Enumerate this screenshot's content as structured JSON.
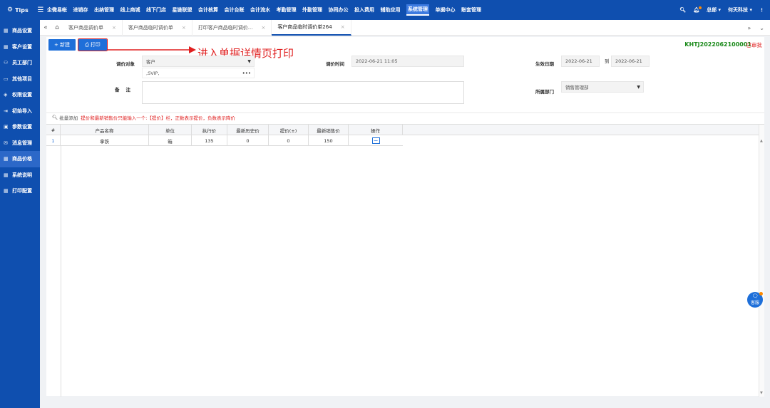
{
  "app": {
    "brand": "Tips"
  },
  "nav": {
    "items": [
      "企微易帐",
      "进销存",
      "出纳管理",
      "线上商城",
      "线下门店",
      "星链联盟",
      "会计核算",
      "会计台账",
      "会计流水",
      "考勤管理",
      "外勤管理",
      "协同办公",
      "投入费用",
      "辅助应用",
      "系统管理",
      "单据中心",
      "账套管理"
    ],
    "active_index": 14,
    "user": "总部",
    "company": "何天科技"
  },
  "sidebar": {
    "items": [
      {
        "icon": "grid-icon",
        "label": "商品设置"
      },
      {
        "icon": "grid-icon",
        "label": "客户设置"
      },
      {
        "icon": "user-icon",
        "label": "员工部门"
      },
      {
        "icon": "folder-icon",
        "label": "其他项目"
      },
      {
        "icon": "shield-icon",
        "label": "权限设置"
      },
      {
        "icon": "import-icon",
        "label": "初始导入"
      },
      {
        "icon": "settings-icon",
        "label": "参数设置"
      },
      {
        "icon": "message-icon",
        "label": "消息管理"
      },
      {
        "icon": "grid-icon",
        "label": "商品价格"
      },
      {
        "icon": "grid-icon",
        "label": "系统说明"
      },
      {
        "icon": "grid-icon",
        "label": "打印配置"
      }
    ],
    "active_index": 8
  },
  "tabs": [
    {
      "label": "客户商品调价单"
    },
    {
      "label": "客户商品临时调价单"
    },
    {
      "label": "打印客户商品临时调价..."
    },
    {
      "label": "客户商品临时调价单264"
    }
  ],
  "toolbar": {
    "new_label": "+ 新建",
    "print_label": "打印"
  },
  "annotation": "进入单据详情页打印",
  "doc": {
    "number": "KHTJ2022062100001",
    "status": "已审批"
  },
  "form": {
    "target_label": "调价对象",
    "target_value": "客户",
    "target_sub_value": ",SVIP,",
    "time_label": "调价时间",
    "time_value": "2022-06-21 11:05",
    "effective_label": "生效日期",
    "effective_from": "2022-06-21",
    "to_label": "到",
    "effective_to": "2022-06-21",
    "remark_label": "备    注",
    "dept_label": "所属部门",
    "dept_value": "销售管理部"
  },
  "grid": {
    "batch_add": "批量添加",
    "hint": "提价和最新销售价只能输入一个:【提价】栏，正数表示提价，负数表示降价",
    "columns": [
      "#",
      "产品名称",
      "单位",
      "执行价",
      "最新历史价",
      "提价(±)",
      "最新销售价",
      "操作"
    ],
    "rows": [
      {
        "index": "1",
        "product": "拿铁",
        "unit": "箱",
        "exec_price": "135",
        "last_hist_price": "0",
        "raise": "0",
        "last_sale_price": "150"
      }
    ]
  },
  "float_btn": {
    "label": "客服"
  },
  "colors": {
    "primary": "#0f4faf",
    "accent": "#1e6fd9",
    "danger": "#e02020",
    "success": "#1a8a1a"
  }
}
